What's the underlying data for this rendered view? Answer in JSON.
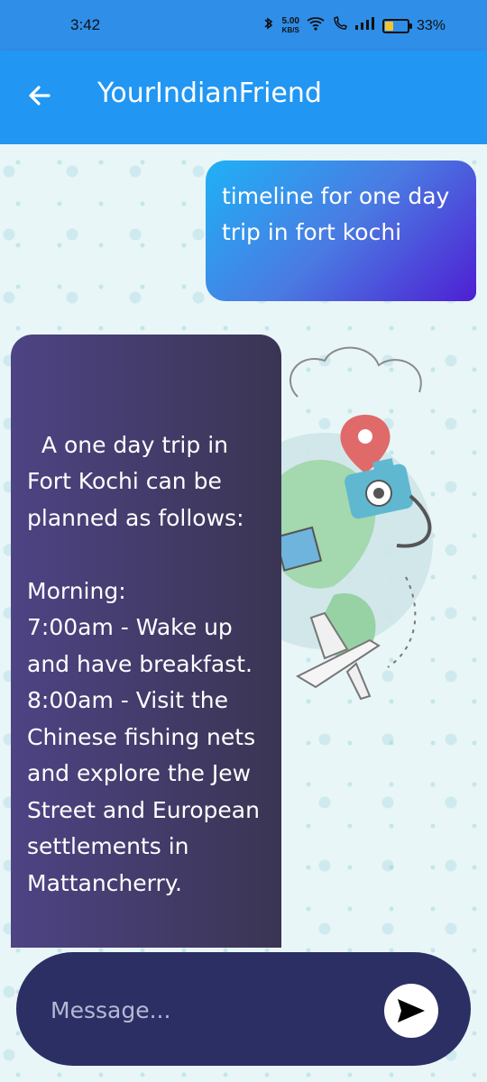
{
  "status_bar": {
    "time": "3:42",
    "net_speed": "5.00",
    "net_speed_unit": "KB/S",
    "battery_percent": "33%",
    "battery_level": 0.33
  },
  "app_bar": {
    "title": "YourIndianFriend",
    "back_icon": "arrow-left-icon"
  },
  "messages": [
    {
      "sender": "user",
      "text": "timeline for one day trip in fort kochi"
    },
    {
      "sender": "bot",
      "text": "A one day trip in Fort Kochi can be planned as follows:\n\nMorning:\n7:00am - Wake up and have breakfast.\n8:00am - Visit the Chinese fishing nets and explore the Jew Street and European settlements in Mattancherry."
    }
  ],
  "composer": {
    "placeholder": "Message...",
    "send_icon": "send-icon"
  },
  "colors": {
    "app_bar": "#2196f3",
    "user_bubble_start": "#1fb1f6",
    "user_bubble_end": "#4e1fd3",
    "bot_bubble_start": "#4e4384",
    "bot_bubble_end": "#3a3553",
    "composer": "#2b2f63"
  }
}
